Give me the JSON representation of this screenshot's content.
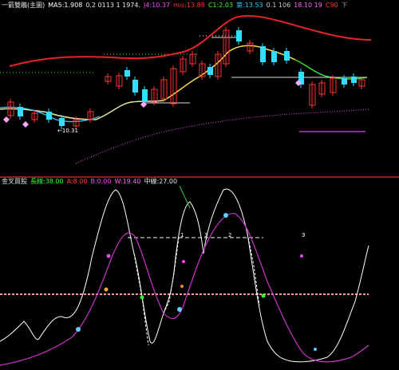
{
  "upper_panel": {
    "header": [
      {
        "text": "一箭雙鵰(主圖)",
        "color": "#e6e6e6"
      },
      {
        "text": "MA5:1.908",
        "color": "#ffffff"
      },
      {
        "text": "0.2 0113 1 1974.",
        "color": "#e6e6e6"
      },
      {
        "text": "J4:10.37",
        "color": "#ff44ff"
      },
      {
        "text": "mis:13.88",
        "color": "#ff3333"
      },
      {
        "text": "C1:2.03",
        "color": "#33ff33"
      },
      {
        "text": "第:13.53",
        "color": "#33ccff"
      },
      {
        "text": "0.1 106",
        "color": "#cccccc"
      },
      {
        "text": "18.10 19",
        "color": "#ff66ff"
      },
      {
        "text": "C90",
        "color": "#ff3333"
      },
      {
        "text": "下",
        "color": "#888888"
      }
    ],
    "low_price_label": "←10.31"
  },
  "lower_panel": {
    "header": [
      {
        "text": "金叉買股",
        "color": "#e6e6e6"
      },
      {
        "text": "長線:38.00",
        "color": "#33ff33"
      },
      {
        "text": "A:8.00",
        "color": "#ff4444"
      },
      {
        "text": "B:0.00",
        "color": "#ff44ff"
      },
      {
        "text": "W:19.40",
        "color": "#ff66ff"
      },
      {
        "text": "中線:27.00",
        "color": "#e6e6e6"
      }
    ],
    "dashed_level_labels": [
      "1",
      "3",
      "2",
      "3"
    ]
  },
  "colors": {
    "background": "#000000",
    "divider": "#9a1a1a",
    "up_candle": "#ff3333",
    "down_candle": "#33ddff",
    "ma_long": "#e8222a",
    "ma_short": "#33ffff",
    "support_curve": "#ff44ff",
    "dashed_level": "#ff9999"
  },
  "icons": [
    "diamond-marker-icon",
    "dot-marker-icon"
  ]
}
